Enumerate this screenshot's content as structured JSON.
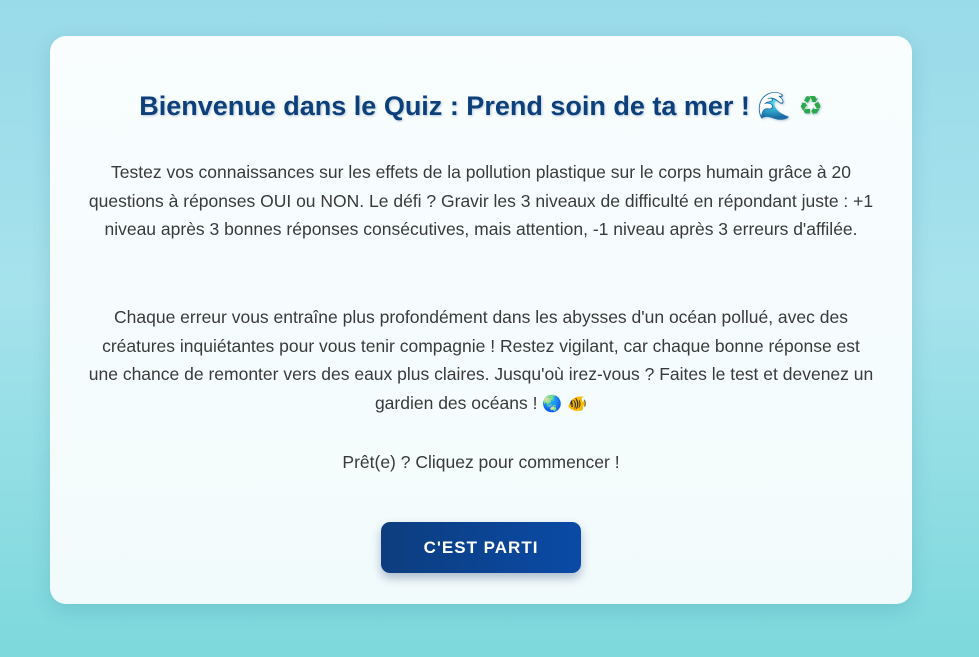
{
  "quiz": {
    "title": "Bienvenue dans le Quiz : Prend soin de ta mer !",
    "title_icons": [
      "wave-icon",
      "recycle-icon"
    ],
    "title_icon_glyphs": {
      "wave": "🌊",
      "recycle": "♻"
    },
    "intro_paragraph": "Testez vos connaissances sur les effets de la pollution plastique sur le corps humain grâce à 20 questions à réponses OUI ou NON. Le défi ? Gravir les 3 niveaux de difficulté en répondant juste : +1 niveau après 3 bonnes réponses consécutives, mais attention, -1 niveau après 3 erreurs d'affilée.",
    "story_paragraph": "Chaque erreur vous entraîne plus profondément dans les abysses d'un océan pollué, avec des créatures inquiétantes pour vous tenir compagnie ! Restez vigilant, car chaque bonne réponse est une chance de remonter vers des eaux plus claires. Jusqu'où irez-vous ? Faites le test et devenez un gardien des océans !",
    "story_icons": [
      "globe-icon",
      "fish-icon"
    ],
    "story_icon_glyphs": {
      "globe": "🌏",
      "fish": "🐠"
    },
    "ready_text": "Prêt(e) ? Cliquez pour commencer !",
    "start_button_label": "C'EST PARTI"
  },
  "colors": {
    "title": "#0d3f7a",
    "button_start": "#0d3d7e",
    "button_end": "#0a4aa6",
    "text": "#3a3a3a",
    "background_top": "#9adbe9",
    "background_bottom": "#7dd9dc",
    "card": "#f9fdfe"
  }
}
